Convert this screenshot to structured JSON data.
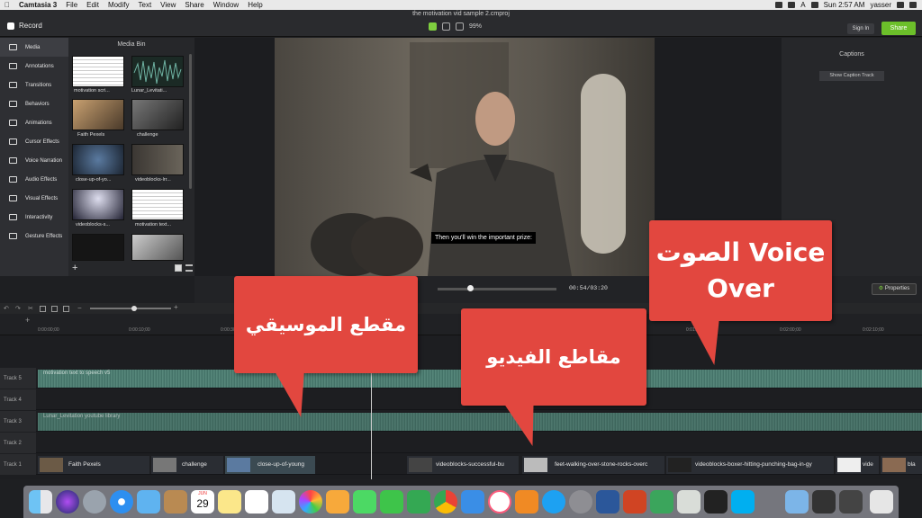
{
  "menubar": {
    "app": "Camtasia 3",
    "menus": [
      "File",
      "Edit",
      "Modify",
      "Text",
      "View",
      "Share",
      "Window",
      "Help"
    ],
    "clock": "Sun 2:57 AM",
    "user": "yasser",
    "kbd": "A"
  },
  "header": {
    "project_title": "the motivation vid sample 2.cmproj",
    "record_label": "Record",
    "zoom": "99%",
    "signin_label": "Sign In",
    "share_label": "Share"
  },
  "leftnav": {
    "items": [
      {
        "label": "Media",
        "icon": "media-icon"
      },
      {
        "label": "Annotations",
        "icon": "annotations-icon"
      },
      {
        "label": "Transitions",
        "icon": "transitions-icon"
      },
      {
        "label": "Behaviors",
        "icon": "behaviors-icon"
      },
      {
        "label": "Animations",
        "icon": "animations-icon"
      },
      {
        "label": "Cursor Effects",
        "icon": "cursor-icon"
      },
      {
        "label": "Voice Narration",
        "icon": "microphone-icon"
      },
      {
        "label": "Audio Effects",
        "icon": "speaker-icon"
      },
      {
        "label": "Visual Effects",
        "icon": "wand-icon"
      },
      {
        "label": "Interactivity",
        "icon": "interactivity-icon"
      },
      {
        "label": "Gesture Effects",
        "icon": "hand-icon"
      }
    ]
  },
  "mediabin": {
    "title": "Media Bin",
    "items": [
      {
        "label": "motivation scri..."
      },
      {
        "label": "Lunar_Levitati..."
      },
      {
        "label": "Faith Pexels"
      },
      {
        "label": "challenge"
      },
      {
        "label": "close-up-of-yo..."
      },
      {
        "label": "videoblocks-lrr..."
      },
      {
        "label": "videoblocks-s..."
      },
      {
        "label": "motivation text..."
      }
    ]
  },
  "canvas": {
    "caption": "Then you'll win the important prize:"
  },
  "captions": {
    "title": "Captions",
    "button": "Show Caption Track"
  },
  "playback": {
    "timecode": "00:54/03:20",
    "progress": 0.27,
    "properties_label": "Properties"
  },
  "timeline": {
    "ruler_ticks": [
      "0:00:00;00",
      "0:00:10;00",
      "0:00:30;00",
      "0:01:40;00",
      "0:02:00;00",
      "0:02:10;00"
    ],
    "tracks": [
      {
        "name": "Track 5",
        "clip": "motivation text to speech v5"
      },
      {
        "name": "Track 4",
        "clip": ""
      },
      {
        "name": "Track 3",
        "clip": "Lunar_Levitation youtube library"
      },
      {
        "name": "Track 2",
        "clip": ""
      },
      {
        "name": "Track 1",
        "clip": ""
      }
    ],
    "video_clips": [
      "Faith Pexels",
      "challenge",
      "close-up-of-young",
      "videoblocks-successful-bu",
      "feet-walking-over-stone-rocks-overc",
      "videoblocks-boxer-hitting-punching-bag-in-gy",
      "vide",
      "bla"
    ]
  },
  "callouts": {
    "music": "مقطع الموسيقي",
    "video": "مقاطع الفيديو",
    "voice_line1": "الصوت Voice",
    "voice_line2": "Over"
  },
  "dock": {
    "calendar_day": "29",
    "calendar_month": "JUN",
    "icons": [
      "finder-icon",
      "siri-icon",
      "launchpad-icon",
      "safari-icon",
      "mail-icon",
      "contacts-icon",
      "calendar-icon",
      "notes-icon",
      "reminders-icon",
      "preview-icon",
      "photos-icon",
      "messages-icon",
      "facetime-icon",
      "numbers-icon",
      "chrome-icon",
      "keynote-icon",
      "itunes-icon",
      "ibooks-icon",
      "appstore-icon",
      "system-preferences-icon",
      "word-icon",
      "powerpoint-icon",
      "camtasia-icon",
      "script-icon",
      "terminal-icon",
      "skype-icon",
      "folder-icon",
      "window-icon",
      "window2-icon",
      "trash-icon"
    ]
  }
}
